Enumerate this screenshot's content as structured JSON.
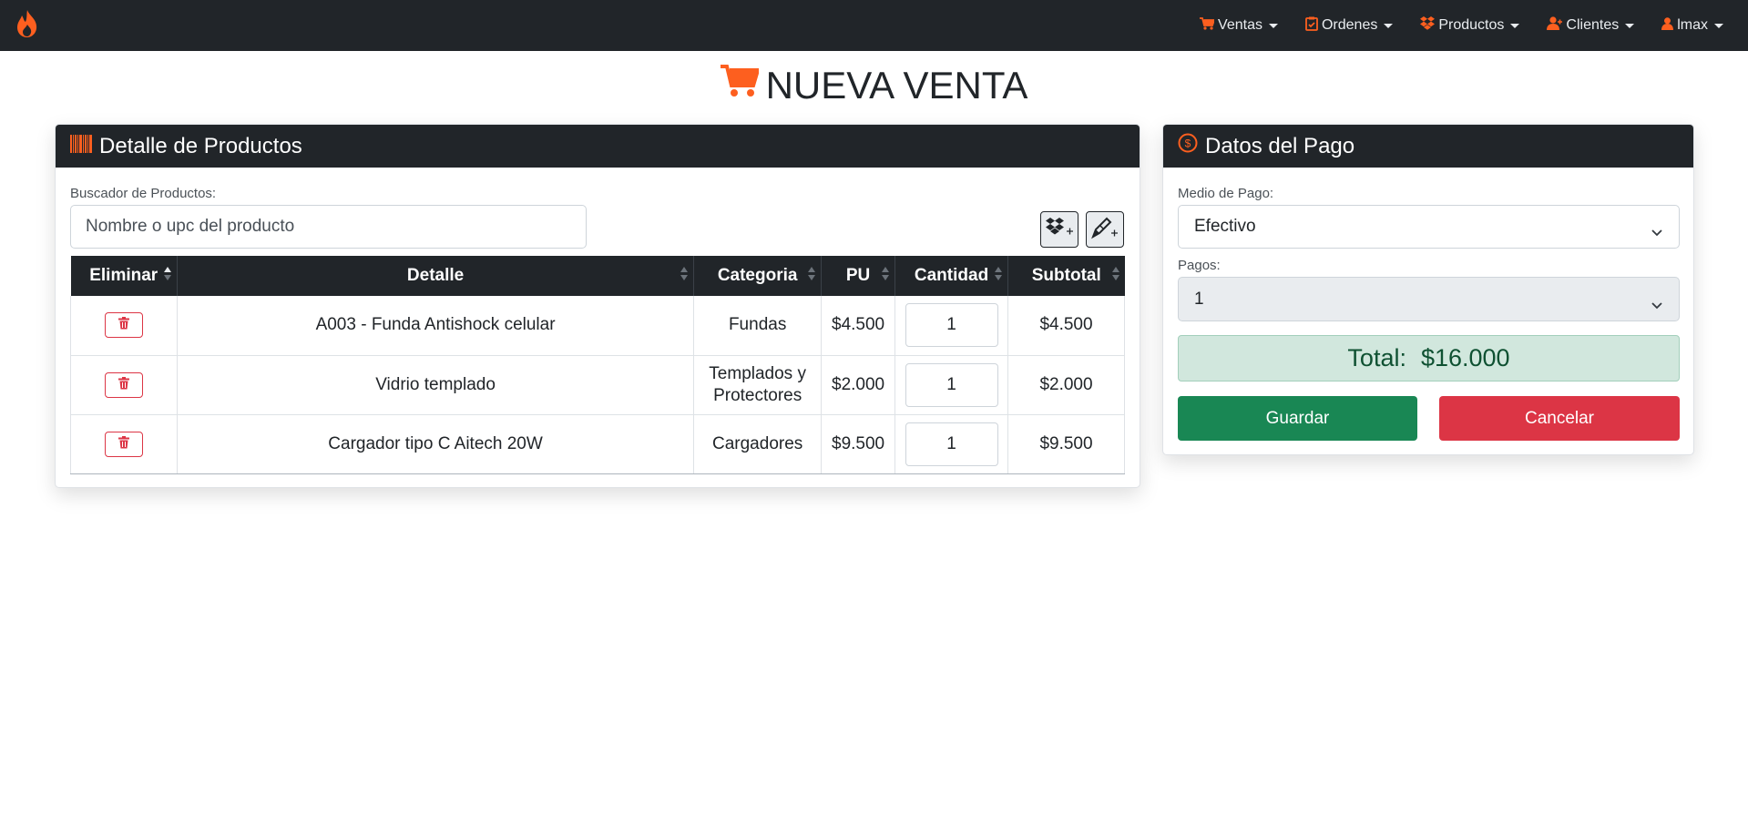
{
  "colors": {
    "accent": "#fd5f1f",
    "dark": "#212529",
    "success": "#198754",
    "danger": "#dc3545",
    "total_bg": "#d1e7dd"
  },
  "nav": {
    "brand_icon": "fire-icon",
    "items": [
      {
        "label": "Ventas",
        "icon": "cart-icon"
      },
      {
        "label": "Ordenes",
        "icon": "clipboard-check-icon"
      },
      {
        "label": "Productos",
        "icon": "dropbox-icon"
      },
      {
        "label": "Clientes",
        "icon": "user-plus-icon"
      },
      {
        "label": "lmax",
        "icon": "user-icon"
      }
    ]
  },
  "page": {
    "title": "NUEVA VENTA",
    "title_icon": "cart-icon"
  },
  "products": {
    "header": "Detalle de Productos",
    "header_icon": "barcode-icon",
    "search_label": "Buscador de Productos:",
    "search_placeholder": "Nombre o upc del producto",
    "add_product_icon": "dropbox-plus-icon",
    "add_custom_icon": "pencil-plus-icon",
    "columns": [
      "Eliminar",
      "Detalle",
      "Categoria",
      "PU",
      "Cantidad",
      "Subtotal"
    ],
    "rows": [
      {
        "detail": "A003 - Funda Antishock celular",
        "category": "Fundas",
        "category_line2": "",
        "pu": "$4.500",
        "qty": "1",
        "subtotal": "$4.500"
      },
      {
        "detail": "Vidrio templado",
        "category": "Templados y",
        "category_line2": "Protectores",
        "pu": "$2.000",
        "qty": "1",
        "subtotal": "$2.000"
      },
      {
        "detail": "Cargador tipo C Aitech 20W",
        "category": "Cargadores",
        "category_line2": "",
        "pu": "$9.500",
        "qty": "1",
        "subtotal": "$9.500"
      }
    ]
  },
  "payment": {
    "header": "Datos del Pago",
    "header_icon": "dollar-circle-icon",
    "method_label": "Medio de Pago:",
    "method_value": "Efectivo",
    "installments_label": "Pagos:",
    "installments_value": "1",
    "total_label": "Total:",
    "total_value": "$16.000",
    "save_label": "Guardar",
    "cancel_label": "Cancelar"
  }
}
